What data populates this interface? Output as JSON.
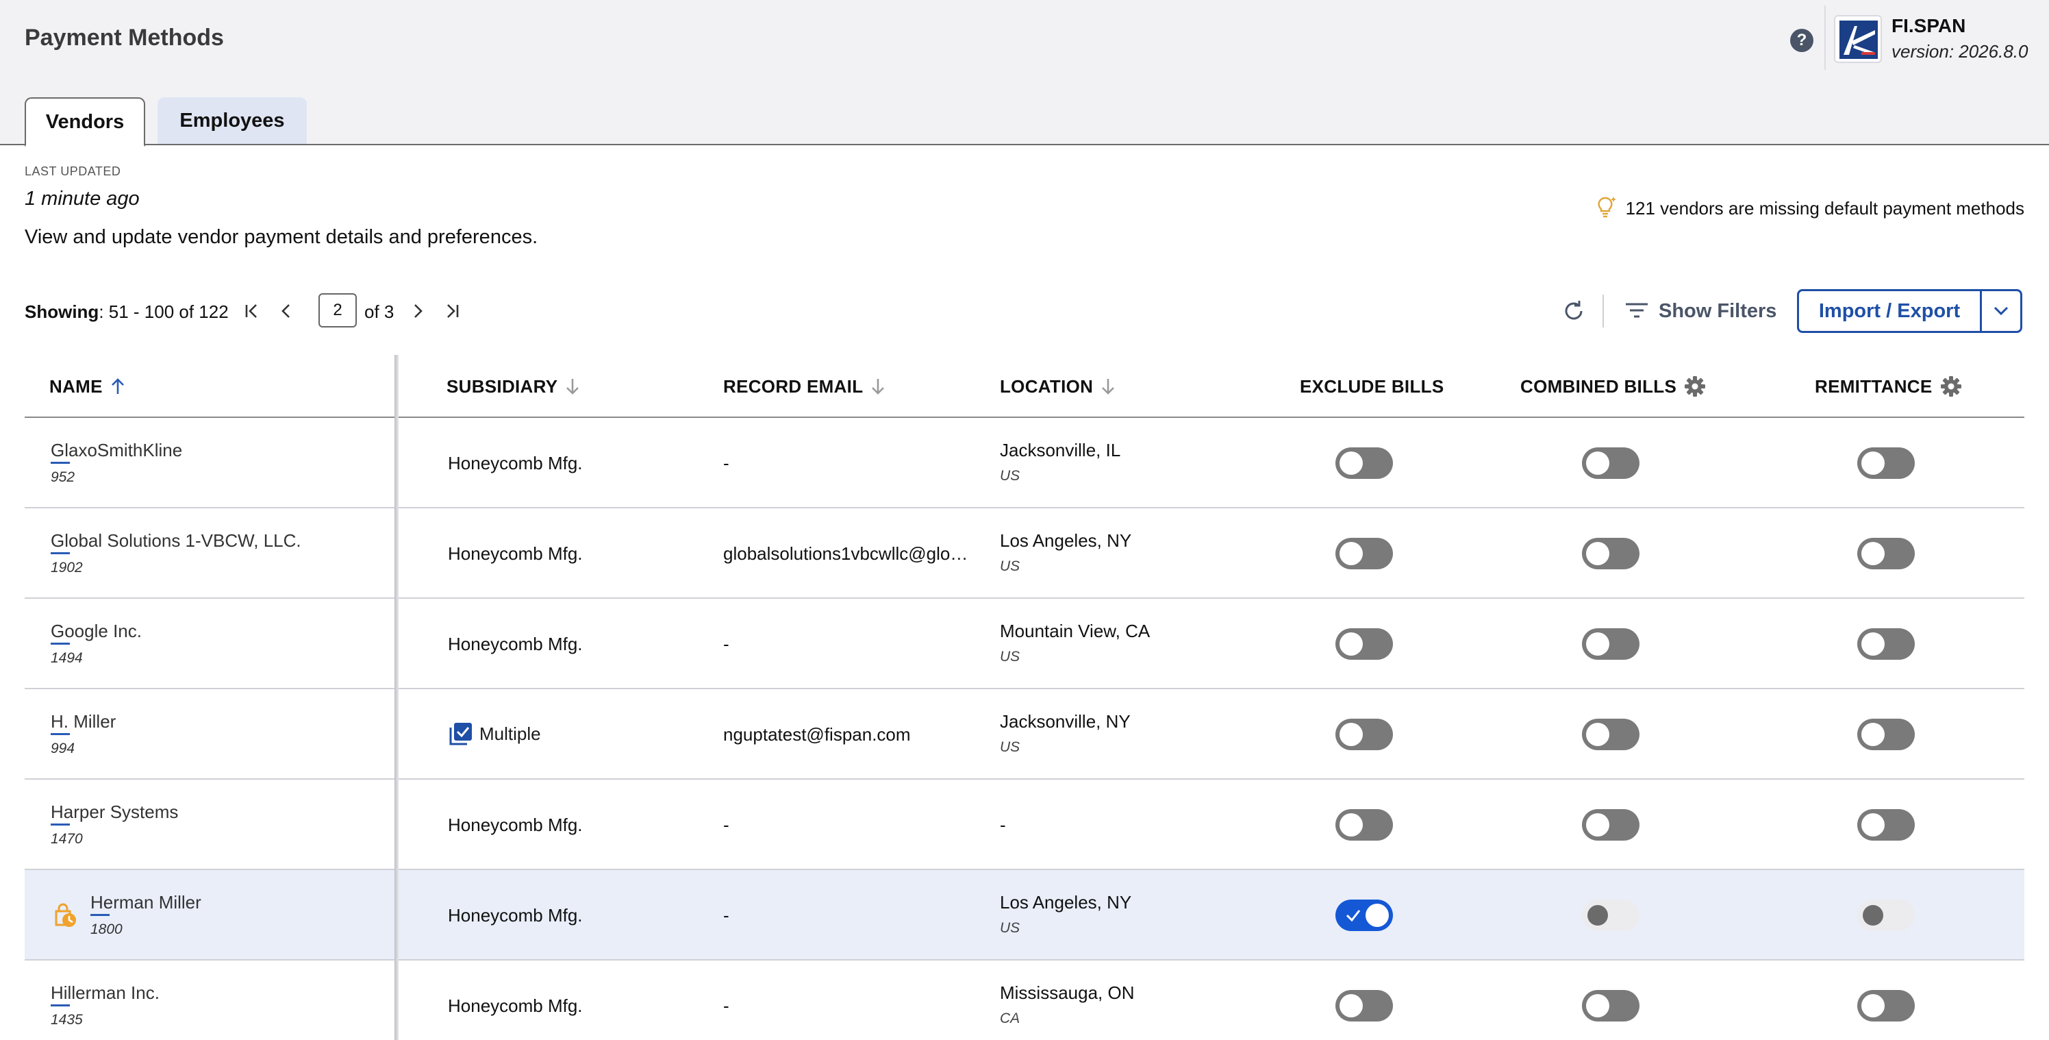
{
  "header": {
    "title": "Payment Methods",
    "brand_name": "FI.SPAN",
    "version": "version: 2026.8.0"
  },
  "tabs": [
    {
      "label": "Vendors",
      "active": true
    },
    {
      "label": "Employees",
      "active": false
    }
  ],
  "info": {
    "last_updated_label": "LAST UPDATED",
    "last_updated_value": "1 minute ago",
    "description": "View and update vendor payment details and preferences.",
    "missing_notice": "121 vendors are missing default payment methods"
  },
  "pagination": {
    "showing_label": "Showing",
    "showing_range": ": 51 - 100 of 122",
    "current_page": "2",
    "of_pages": "of 3"
  },
  "toolbar": {
    "show_filters": "Show Filters",
    "import_export": "Import / Export"
  },
  "columns": {
    "name": "NAME",
    "subsidiary": "SUBSIDIARY",
    "record_email": "RECORD EMAIL",
    "location": "LOCATION",
    "exclude_bills": "EXCLUDE BILLS",
    "combined_bills": "COMBINED BILLS",
    "remittance": "REMITTANCE"
  },
  "colors": {
    "accent": "#1f4fa6",
    "toggle_on": "#1558d6",
    "toggle_off": "#7a7a7a",
    "pending_icon": "#f0a22c"
  },
  "rows": [
    {
      "name": "GlaxoSmithKline",
      "id": "952",
      "subsidiary": "Honeycomb Mfg.",
      "email": "-",
      "city": "Jacksonville, IL",
      "country": "US",
      "exclude": "off",
      "combined": "off",
      "remittance": "off"
    },
    {
      "name": "Global Solutions 1-VBCW, LLC.",
      "id": "1902",
      "subsidiary": "Honeycomb Mfg.",
      "email": "globalsolutions1vbcwllc@glo…",
      "city": "Los Angeles, NY",
      "country": "US",
      "exclude": "off",
      "combined": "off",
      "remittance": "off"
    },
    {
      "name": "Google Inc.",
      "id": "1494",
      "subsidiary": "Honeycomb Mfg.",
      "email": "-",
      "city": "Mountain View, CA",
      "country": "US",
      "exclude": "off",
      "combined": "off",
      "remittance": "off"
    },
    {
      "name": "H. Miller",
      "id": "994",
      "subsidiary": "Multiple",
      "email": "nguptatest@fispan.com",
      "city": "Jacksonville, NY",
      "country": "US",
      "exclude": "off",
      "combined": "off",
      "remittance": "off"
    },
    {
      "name": "Harper Systems",
      "id": "1470",
      "subsidiary": "Honeycomb Mfg.",
      "email": "-",
      "city": "-",
      "country": "",
      "exclude": "off",
      "combined": "off",
      "remittance": "off"
    },
    {
      "name": "Herman Miller",
      "id": "1800",
      "subsidiary": "Honeycomb Mfg.",
      "email": "-",
      "city": "Los Angeles, NY",
      "country": "US",
      "exclude": "on",
      "combined": "disabled",
      "remittance": "disabled",
      "pending": true
    },
    {
      "name": "Hillerman Inc.",
      "id": "1435",
      "subsidiary": "Honeycomb Mfg.",
      "email": "-",
      "city": "Mississauga, ON",
      "country": "CA",
      "exclude": "off",
      "combined": "off",
      "remittance": "off"
    }
  ]
}
